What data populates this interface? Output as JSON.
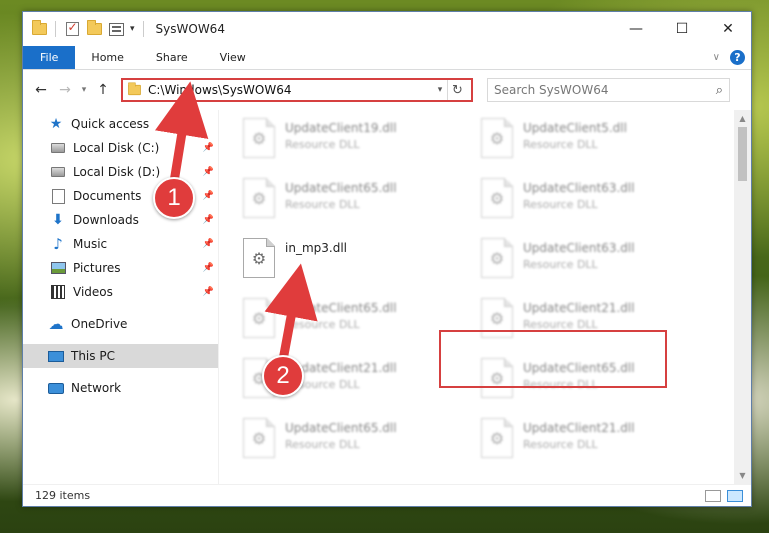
{
  "window": {
    "title": "SysWOW64",
    "controls": {
      "minimize": "—",
      "maximize": "☐",
      "close": "✕"
    }
  },
  "ribbon": {
    "tabs": [
      "File",
      "Home",
      "Share",
      "View"
    ],
    "help": "?"
  },
  "nav": {
    "back": "←",
    "forward": "→",
    "recent": "▾",
    "up": "↑"
  },
  "address": {
    "path": "C:\\Windows\\SysWOW64",
    "dropdown": "▾",
    "refresh": "↻"
  },
  "search": {
    "placeholder": "Search SysWOW64",
    "icon": "⌕"
  },
  "sidebar": {
    "quick_access": "Quick access",
    "items": [
      {
        "label": "Local Disk (C:)",
        "icon": "disk"
      },
      {
        "label": "Local Disk (D:)",
        "icon": "disk"
      },
      {
        "label": "Documents",
        "icon": "documents"
      },
      {
        "label": "Downloads",
        "icon": "downloads"
      },
      {
        "label": "Music",
        "icon": "music"
      },
      {
        "label": "Pictures",
        "icon": "pictures"
      },
      {
        "label": "Videos",
        "icon": "videos"
      }
    ],
    "onedrive": "OneDrive",
    "this_pc": "This PC",
    "network": "Network"
  },
  "files": [
    {
      "name": "UpdateClient19.dll",
      "type": "Resource DLL"
    },
    {
      "name": "UpdateClient5.dll",
      "type": "Resource DLL"
    },
    {
      "name": "UpdateClient65.dll",
      "type": "Resource DLL"
    },
    {
      "name": "UpdateClient63.dll",
      "type": "Resource DLL"
    },
    {
      "name": "in_mp3.dll",
      "type": ""
    },
    {
      "name": "UpdateClient63.dll",
      "type": "Resource DLL"
    },
    {
      "name": "UpdateClient65.dll",
      "type": "Resource DLL"
    },
    {
      "name": "UpdateClient21.dll",
      "type": "Resource DLL"
    },
    {
      "name": "UpdateClient21.dll",
      "type": "Resource DLL"
    },
    {
      "name": "UpdateClient65.dll",
      "type": "Resource DLL"
    },
    {
      "name": "UpdateClient65.dll",
      "type": "Resource DLL"
    },
    {
      "name": "UpdateClient21.dll",
      "type": "Resource DLL"
    }
  ],
  "status": {
    "item_count": "129 items"
  },
  "annotations": {
    "step1": "1",
    "step2": "2",
    "color": "#e03c3c"
  }
}
